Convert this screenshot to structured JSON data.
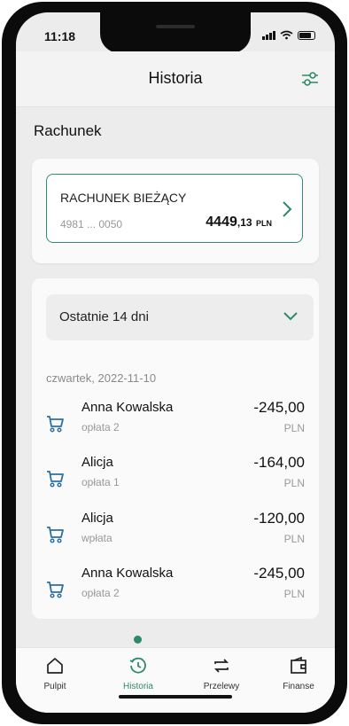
{
  "status_bar": {
    "time": "11:18"
  },
  "header": {
    "title": "Historia",
    "filter_icon": "sliders-icon"
  },
  "section_title": "Rachunek",
  "account": {
    "name": "RACHUNEK BIEŻĄCY",
    "number": "4981 ... 0050",
    "balance_int": "4449",
    "balance_dec": ",13",
    "currency": "PLN"
  },
  "history": {
    "period": "Ostatnie 14 dni",
    "date": "czwartek, 2022-11-10",
    "transactions": [
      {
        "name": "Anna Kowalska",
        "desc": "opłata 2",
        "amount": "-245,00",
        "currency": "PLN",
        "icon": "cart-icon"
      },
      {
        "name": "Alicja",
        "desc": "opłata 1",
        "amount": "-164,00",
        "currency": "PLN",
        "icon": "cart-icon"
      },
      {
        "name": "Alicja",
        "desc": "wpłata",
        "amount": "-120,00",
        "currency": "PLN",
        "icon": "cart-icon"
      },
      {
        "name": "Anna Kowalska",
        "desc": "opłata 2",
        "amount": "-245,00",
        "currency": "PLN",
        "icon": "cart-icon"
      }
    ]
  },
  "tabs": [
    {
      "label": "Pulpit",
      "icon": "home-icon",
      "active": false
    },
    {
      "label": "Historia",
      "icon": "history-icon",
      "active": true
    },
    {
      "label": "Przelewy",
      "icon": "transfer-icon",
      "active": false
    },
    {
      "label": "Finanse",
      "icon": "wallet-icon",
      "active": false
    }
  ],
  "colors": {
    "accent": "#2e8a66",
    "background": "#ececec",
    "card": "#fafafa"
  }
}
